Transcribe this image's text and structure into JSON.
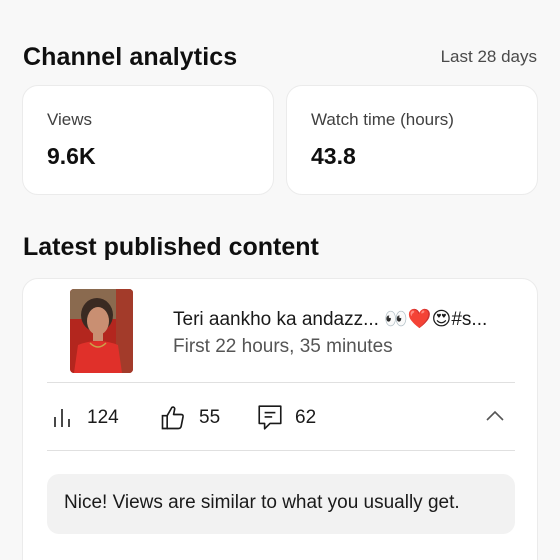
{
  "header": {
    "title": "Channel analytics",
    "period": "Last 28 days"
  },
  "stats": {
    "views": {
      "label": "Views",
      "value": "9.6K"
    },
    "watch_time": {
      "label": "Watch time (hours)",
      "value": "43.8"
    }
  },
  "latest": {
    "section_title": "Latest published content",
    "video": {
      "title": "Teri aankho ka andazz... 👀❤️😍#s...",
      "subtitle": "First 22 hours, 35 minutes",
      "thumbnail": "video-thumbnail"
    },
    "metrics": {
      "views": {
        "icon": "bar-chart-icon",
        "value": "124"
      },
      "likes": {
        "icon": "thumbs-up-icon",
        "value": "55"
      },
      "comments": {
        "icon": "comment-icon",
        "value": "62"
      }
    },
    "insight": "Nice! Views are similar to what you usually get."
  },
  "colors": {
    "background": "#f8f8f8",
    "card": "#ffffff",
    "insight_bg": "#f2f2f2"
  }
}
